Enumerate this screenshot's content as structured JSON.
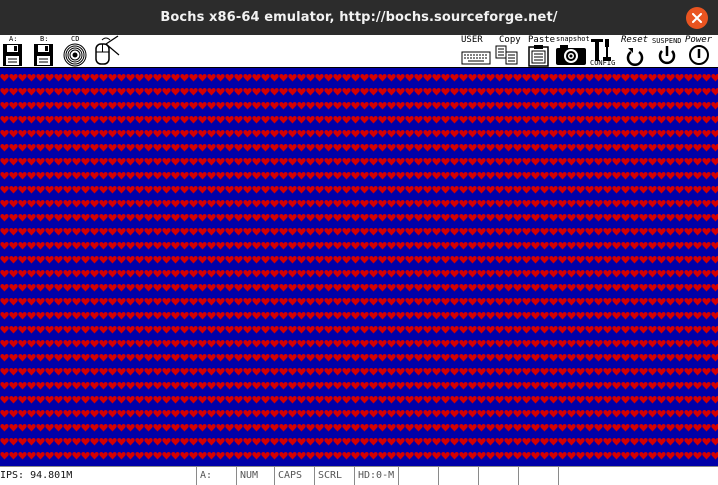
{
  "window": {
    "title": "Bochs x86-64 emulator, http://bochs.sourceforge.net/"
  },
  "toolbar": {
    "floppy_a_label": "A:",
    "floppy_b_label": "B:",
    "cdrom_label": "CD",
    "user_label": "USER",
    "copy_label": "Copy",
    "paste_label": "Paste",
    "snapshot_label": "snapshot",
    "config_label": "CONFIG",
    "reset_label": "Reset",
    "suspend_label": "SUSPEND",
    "power_label": "Power"
  },
  "screen": {
    "background_color": "#0000a8",
    "glyph_color": "#d40000",
    "glyph": "heart",
    "fill": "full-screen repeated heart characters"
  },
  "statusbar": {
    "ips": "IPS: 94.801M",
    "floppy": "A:",
    "num": "NUM",
    "caps": "CAPS",
    "scrl": "SCRL",
    "hd": "HD:0-M",
    "empty_1": "",
    "empty_2": "",
    "empty_3": "",
    "empty_4": "",
    "empty_5": ""
  }
}
